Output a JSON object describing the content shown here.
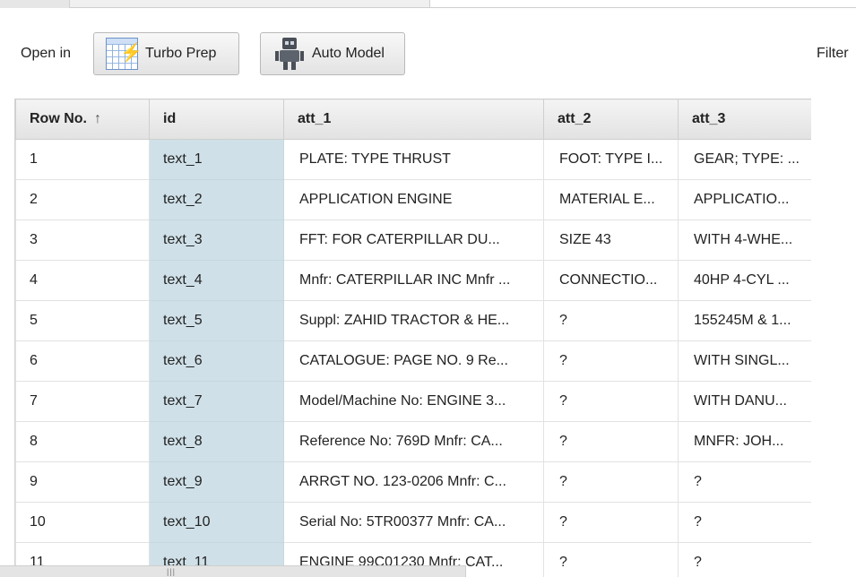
{
  "toolbar": {
    "open_in_label": "Open in",
    "turbo_prep_label": "Turbo Prep",
    "auto_model_label": "Auto Model",
    "filter_label": "Filter"
  },
  "table": {
    "columns": [
      "Row No.",
      "id",
      "att_1",
      "att_2",
      "att_3"
    ],
    "sort_indicator": "↑",
    "rows": [
      [
        "1",
        "text_1",
        "PLATE: TYPE THRUST",
        "FOOT: TYPE I...",
        "GEAR; TYPE: ..."
      ],
      [
        "2",
        "text_2",
        "APPLICATION ENGINE",
        "MATERIAL E...",
        "APPLICATIO..."
      ],
      [
        "3",
        "text_3",
        "FFT: FOR CATERPILLAR DU...",
        "SIZE 43",
        "WITH 4-WHE..."
      ],
      [
        "4",
        "text_4",
        "Mnfr: CATERPILLAR INC Mnfr ...",
        "CONNECTIO...",
        "40HP 4-CYL ..."
      ],
      [
        "5",
        "text_5",
        "Suppl: ZAHID TRACTOR & HE...",
        "?",
        "155245M & 1..."
      ],
      [
        "6",
        "text_6",
        "CATALOGUE: PAGE NO. 9 Re...",
        "?",
        "WITH SINGL..."
      ],
      [
        "7",
        "text_7",
        "Model/Machine No: ENGINE 3...",
        "?",
        "WITH DANU..."
      ],
      [
        "8",
        "text_8",
        "Reference No: 769D Mnfr: CA...",
        "?",
        "MNFR: JOH..."
      ],
      [
        "9",
        "text_9",
        "ARRGT NO. 123-0206 Mnfr: C...",
        "?",
        "?"
      ],
      [
        "10",
        "text_10",
        "Serial No: 5TR00377 Mnfr: CA...",
        "?",
        "?"
      ],
      [
        "11",
        "text_11",
        "ENGINE 99C01230 Mnfr: CAT...",
        "?",
        "?"
      ]
    ]
  },
  "icons": {
    "turbo_prep": "grid-lightning-icon",
    "auto_model": "robot-icon",
    "sort": "sort-ascending-icon"
  }
}
